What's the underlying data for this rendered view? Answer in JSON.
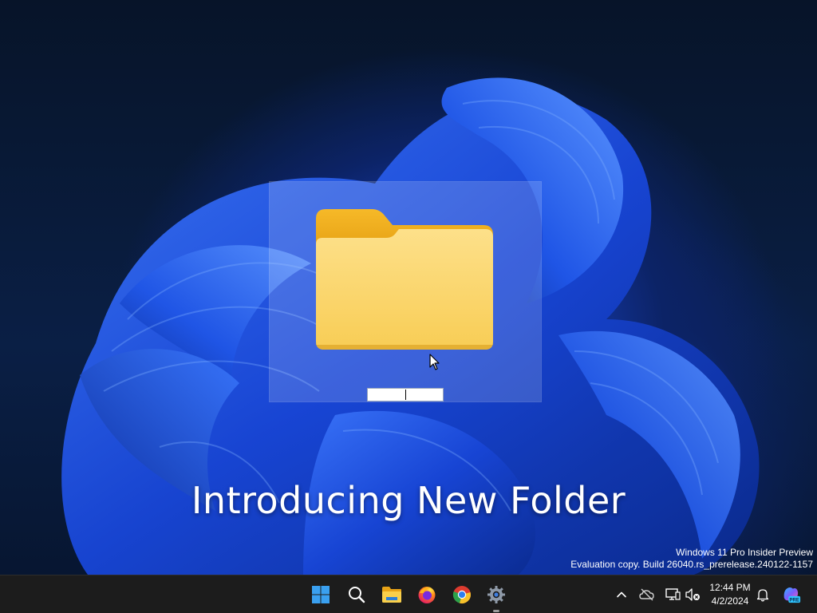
{
  "banner": {
    "text": "Introducing New Folder"
  },
  "desktop": {
    "item": {
      "icon": "folder-icon",
      "name_value": ""
    }
  },
  "watermark": {
    "line1": "Windows 11 Pro Insider Preview",
    "line2": "Evaluation copy. Build 26040.rs_prerelease.240122-1157"
  },
  "taskbar": {
    "apps": [
      {
        "id": "start",
        "icon": "windows-start-icon"
      },
      {
        "id": "search",
        "icon": "search-icon"
      },
      {
        "id": "file-explorer",
        "icon": "file-explorer-icon"
      },
      {
        "id": "firefox",
        "icon": "firefox-icon"
      },
      {
        "id": "chrome",
        "icon": "chrome-icon"
      },
      {
        "id": "settings",
        "icon": "settings-gear-icon"
      }
    ],
    "tray": {
      "icons": [
        "chevron-up-icon",
        "onedrive-offline-icon",
        "network-icon",
        "volume-muted-icon",
        "notifications-bell-icon",
        "copilot-pre-icon"
      ],
      "copilot_badge": "PRE",
      "time": "12:44 PM",
      "date": "4/2/2024"
    }
  },
  "colors": {
    "folder_front": "#fbd66a",
    "folder_back": "#f3b31d",
    "taskbar_bg": "#1c1c1c",
    "wallpaper_blue": "#1d4fd6"
  }
}
